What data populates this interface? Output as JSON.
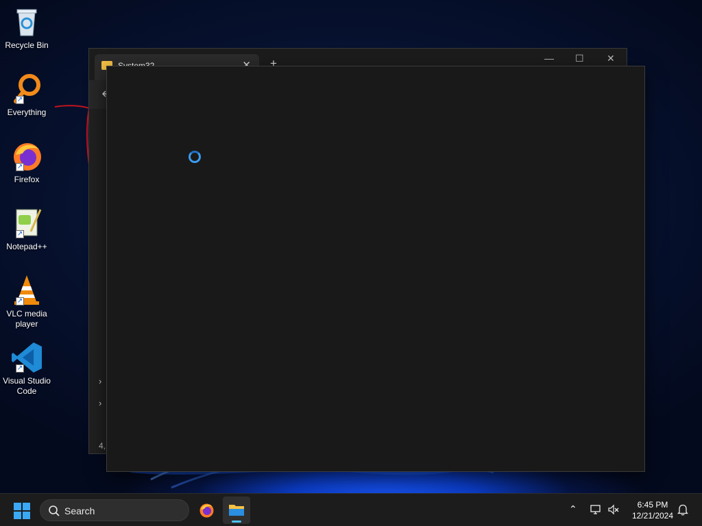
{
  "desktop": {
    "icons": [
      {
        "label": "Recycle Bin",
        "icon": "recycle-bin-icon"
      },
      {
        "label": "Everything",
        "icon": "everything-icon"
      },
      {
        "label": "Firefox",
        "icon": "firefox-icon"
      },
      {
        "label": "Notepad++",
        "icon": "notepadpp-icon"
      },
      {
        "label": "VLC media player",
        "icon": "vlc-icon"
      },
      {
        "label": "Visual Studio Code",
        "icon": "vscode-icon"
      }
    ]
  },
  "explorer": {
    "tab_title": "System32",
    "tab_close": "✕",
    "new_tab": "+",
    "minimize": "—",
    "maximize": "☐",
    "close": "✕",
    "status_partial": "4,"
  },
  "taskbar": {
    "search_label": "Search",
    "apps": [
      {
        "name": "Firefox",
        "icon": "firefox-icon",
        "active": false
      },
      {
        "name": "File Explorer",
        "icon": "file-explorer-icon",
        "active": true
      }
    ],
    "tray_chevron": "^",
    "time": "6:45 PM",
    "date": "12/21/2024"
  },
  "colors": {
    "accent": "#4cc2ff",
    "spinner": "#3b9cf0",
    "window_bg": "#191919"
  }
}
